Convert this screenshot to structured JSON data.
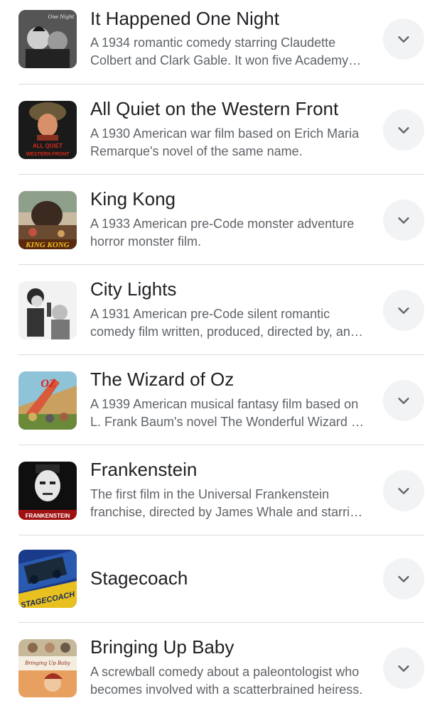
{
  "items": [
    {
      "title": "It Happened One Night",
      "description": "A 1934 romantic comedy starring Claudette Colbert and Clark Gable. It won five Academy Awards.",
      "thumbnail": "movie-poster-it-happened-one-night",
      "poster_text": "One Night"
    },
    {
      "title": "All Quiet on the Western Front",
      "description": "A 1930 American war film based on Erich Maria Remarque's novel of the same name.",
      "thumbnail": "movie-poster-all-quiet",
      "poster_text": "ALL QUIET WESTERN FRONT"
    },
    {
      "title": "King Kong",
      "description": "A 1933 American pre-Code monster adventure horror monster film.",
      "thumbnail": "movie-poster-king-kong",
      "poster_text": "KING KONG"
    },
    {
      "title": "City Lights",
      "description": "A 1931 American pre-Code silent romantic comedy film written, produced, directed by, and starring Charlie Chaplin.",
      "thumbnail": "movie-poster-city-lights"
    },
    {
      "title": "The Wizard of Oz",
      "description": "A 1939 American musical fantasy film based on L. Frank Baum's novel The Wonderful Wizard of Oz.",
      "thumbnail": "movie-poster-wizard-of-oz",
      "poster_text": "OZ"
    },
    {
      "title": "Frankenstein",
      "description": "The first film in the Universal Frankenstein franchise, directed by James Whale and starring Boris Karloff.",
      "thumbnail": "movie-poster-frankenstein",
      "poster_text": "FRANKENSTEIN"
    },
    {
      "title": "Stagecoach",
      "description": "",
      "thumbnail": "movie-poster-stagecoach",
      "poster_text": "STAGECOACH"
    },
    {
      "title": "Bringing Up Baby",
      "description": "A screwball comedy about a paleontologist who becomes involved with a scatterbrained heiress.",
      "thumbnail": "movie-poster-bringing-up-baby",
      "poster_text": "Bringing Up Baby"
    }
  ],
  "icons": {
    "expand": "chevron-down-icon"
  },
  "colors": {
    "title": "#202124",
    "description": "#5f6368",
    "divider": "#dadce0",
    "expand_button_bg": "#f1f3f4",
    "chevron": "#5f6368"
  }
}
